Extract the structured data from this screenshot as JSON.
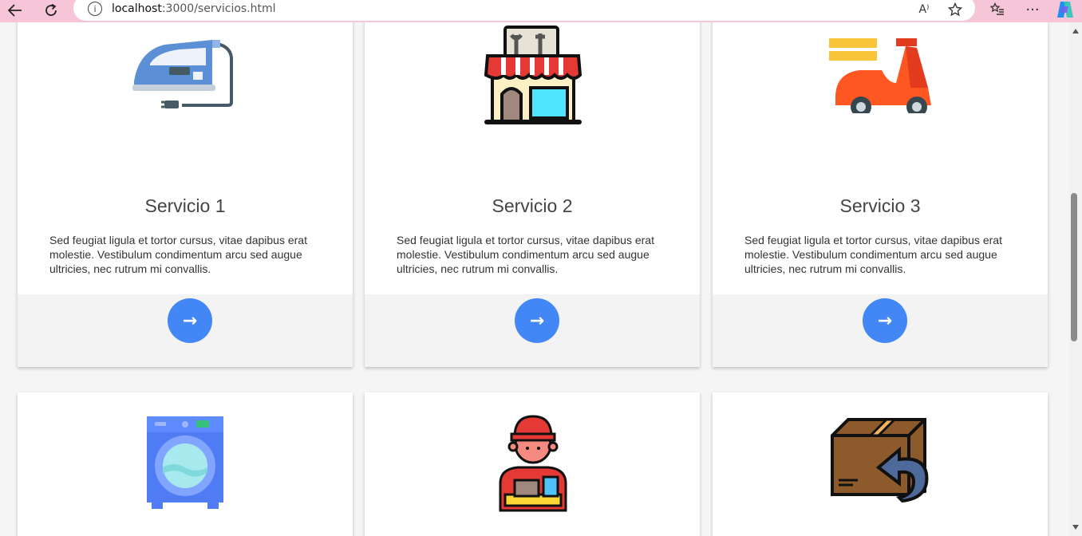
{
  "browser": {
    "url_host": "localhost",
    "url_path": ":3000/servicios.html",
    "back_icon": "arrow-left-icon",
    "reload_icon": "reload-icon",
    "read_aloud_label": "A⁾"
  },
  "cards": [
    {
      "title": "Servicio 1",
      "text": "Sed feugiat ligula et tortor cursus, vitae dapibus erat molestie. Vestibulum condimentum arcu sed augue ultricies, nec rutrum mi convallis.",
      "button": "→",
      "icon": "iron-icon"
    },
    {
      "title": "Servicio 2",
      "text": "Sed feugiat ligula et tortor cursus, vitae dapibus erat molestie. Vestibulum condimentum arcu sed augue ultricies, nec rutrum mi convallis.",
      "button": "→",
      "icon": "repair-shop-icon"
    },
    {
      "title": "Servicio 3",
      "text": "Sed feugiat ligula et tortor cursus, vitae dapibus erat molestie. Vestibulum condimentum arcu sed augue ultricies, nec rutrum mi convallis.",
      "button": "→",
      "icon": "delivery-scooter-icon"
    },
    {
      "icon": "washing-machine-icon"
    },
    {
      "icon": "delivery-person-icon"
    },
    {
      "icon": "return-box-icon"
    }
  ],
  "colors": {
    "accent": "#4287f5",
    "chrome": "#f6c6d8"
  }
}
